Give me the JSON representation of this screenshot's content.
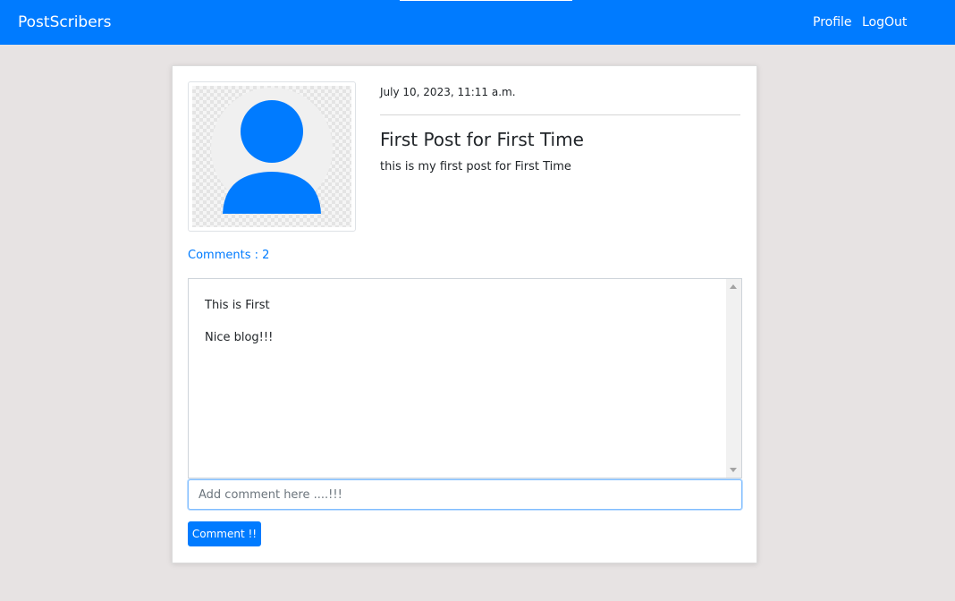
{
  "navbar": {
    "brand": "PostScribers",
    "links": [
      {
        "label": "Profile"
      },
      {
        "label": "LogOut"
      }
    ],
    "color": "#007bff"
  },
  "post": {
    "avatar_icon": "user-avatar-icon",
    "date": "July 10, 2023, 11:11 a.m.",
    "title": "First Post for First Time",
    "body": "this is my first post for First Time"
  },
  "comments": {
    "count_label": "Comments : 2",
    "items": [
      {
        "text": "This is First"
      },
      {
        "text": "Nice blog!!!"
      }
    ],
    "input_placeholder": "Add comment here ....!!!",
    "input_value": "",
    "submit_label": "Comment !!"
  },
  "colors": {
    "accent": "#007bff",
    "page_background": "#e7e3e3"
  }
}
